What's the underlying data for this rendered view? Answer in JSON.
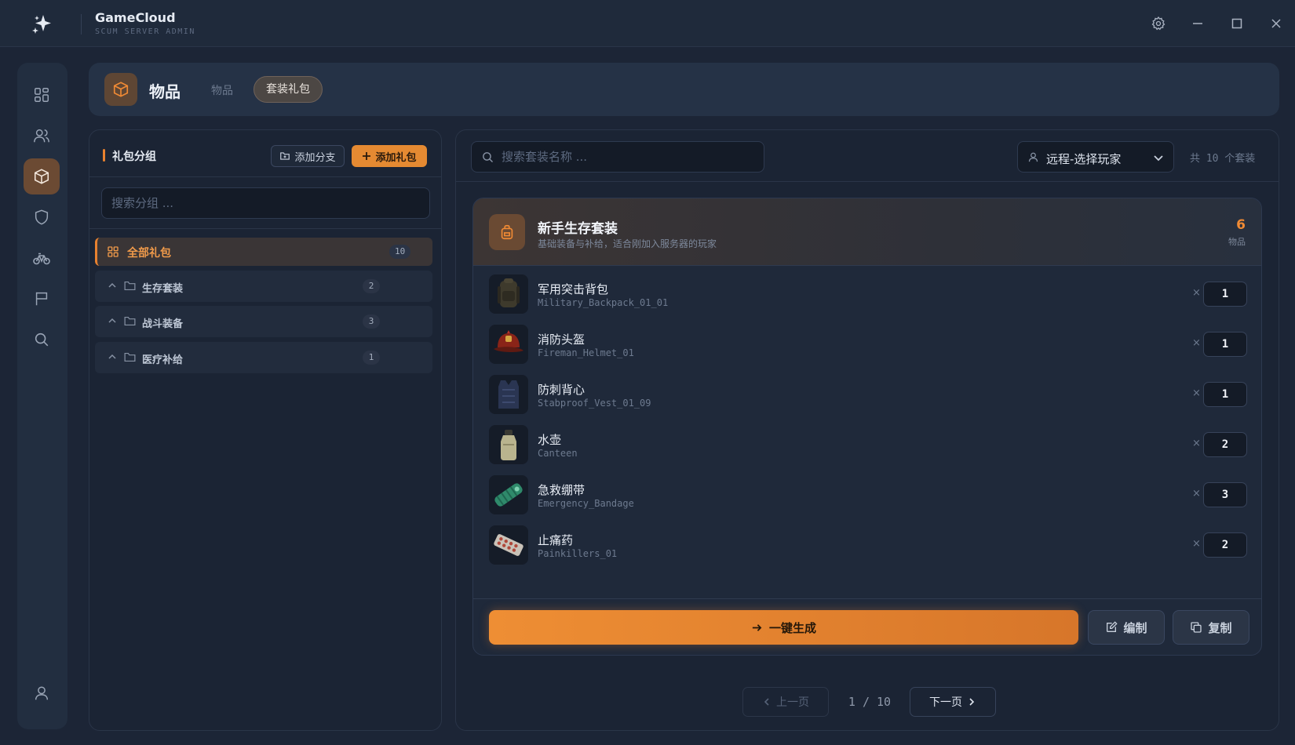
{
  "app": {
    "title": "GameCloud",
    "subtitle": "SCUM SERVER ADMIN"
  },
  "header": {
    "title": "物品",
    "tabs": [
      {
        "label": "物品",
        "active": false
      },
      {
        "label": "套装礼包",
        "active": true
      }
    ]
  },
  "sidebar": {
    "items": [
      {
        "icon": "dashboard-icon",
        "active": false
      },
      {
        "icon": "users-icon",
        "active": false
      },
      {
        "icon": "box-icon",
        "active": true
      },
      {
        "icon": "shield-icon",
        "active": false
      },
      {
        "icon": "bicycle-icon",
        "active": false
      },
      {
        "icon": "flag-icon",
        "active": false
      },
      {
        "icon": "search-icon",
        "active": false
      }
    ],
    "bottom_icon": "user-icon"
  },
  "groups_panel": {
    "title": "礼包分组",
    "add_branch_label": "添加分支",
    "add_kit_label": "添加礼包",
    "search_placeholder": "搜索分组 ...",
    "all": {
      "label": "全部礼包",
      "count": "10"
    },
    "groups": [
      {
        "label": "生存套装",
        "count": "2"
      },
      {
        "label": "战斗装备",
        "count": "3"
      },
      {
        "label": "医疗补给",
        "count": "1"
      }
    ]
  },
  "kits_panel": {
    "search_placeholder": "搜索套装名称 ...",
    "player_select": "远程-选择玩家",
    "total": "共 10 个套装"
  },
  "kit": {
    "name": "新手生存套装",
    "description": "基础装备与补给，适合刚加入服务器的玩家",
    "count": "6",
    "count_label": "物品",
    "items": [
      {
        "name": "军用突击背包",
        "code": "Military_Backpack_01_01",
        "qty": "1",
        "thumb": "backpack"
      },
      {
        "name": "消防头盔",
        "code": "Fireman_Helmet_01",
        "qty": "1",
        "thumb": "helmet"
      },
      {
        "name": "防刺背心",
        "code": "Stabproof_Vest_01_09",
        "qty": "1",
        "thumb": "vest"
      },
      {
        "name": "水壶",
        "code": "Canteen",
        "qty": "2",
        "thumb": "canteen"
      },
      {
        "name": "急救绷带",
        "code": "Emergency_Bandage",
        "qty": "3",
        "thumb": "bandage"
      },
      {
        "name": "止痛药",
        "code": "Painkillers_01",
        "qty": "2",
        "thumb": "pills"
      }
    ],
    "multiply_symbol": "×",
    "generate_label": "一键生成",
    "edit_label": "编制",
    "copy_label": "复制"
  },
  "pagination": {
    "prev_label": "上一页",
    "info": "1 / 10",
    "next_label": "下一页"
  },
  "colors": {
    "accent": "#e8812f",
    "background": "#1c2536",
    "panel": "#1b2434"
  }
}
